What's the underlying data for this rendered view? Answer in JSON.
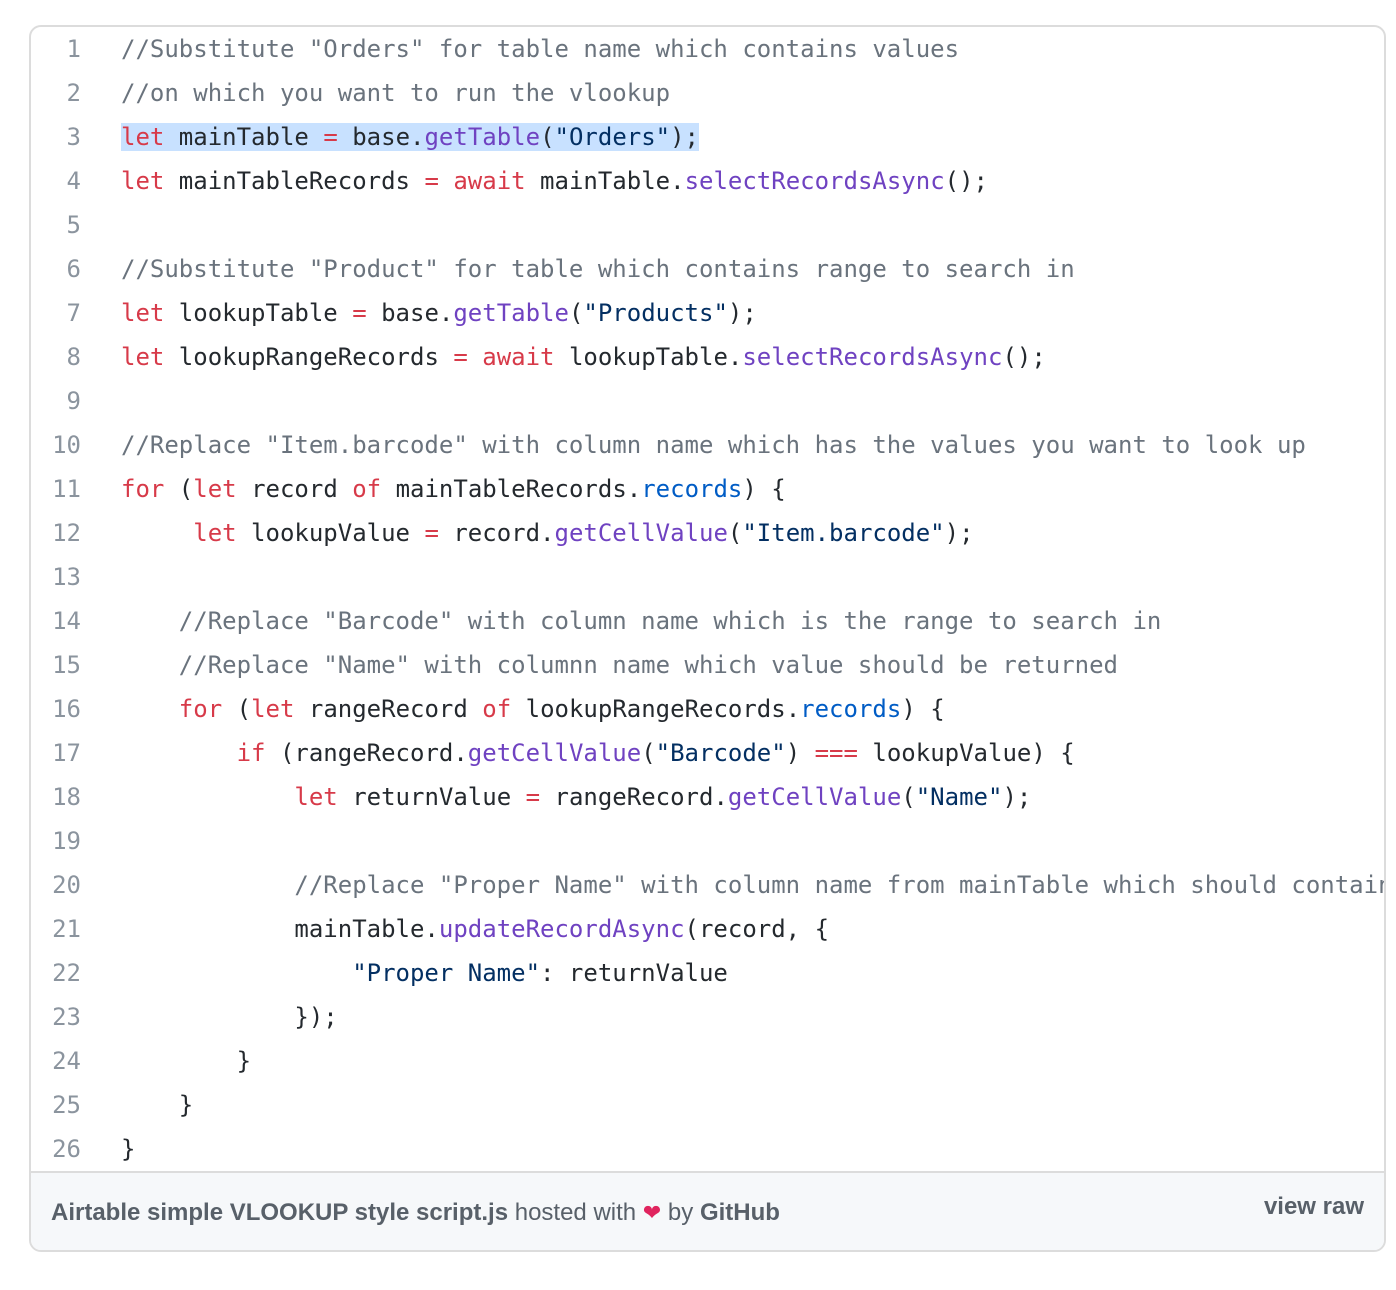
{
  "gist": {
    "filename": "Airtable simple VLOOKUP style script.js",
    "hosted_with": "hosted with",
    "heart_icon": "heart-icon",
    "by": "by",
    "host": "GitHub",
    "view_raw": "view raw"
  },
  "code": {
    "line_numbers": [
      "1",
      "2",
      "3",
      "4",
      "5",
      "6",
      "7",
      "8",
      "9",
      "10",
      "11",
      "12",
      "13",
      "14",
      "15",
      "16",
      "17",
      "18",
      "19",
      "20",
      "21",
      "22",
      "23",
      "24",
      "25",
      "26"
    ],
    "lines": [
      "//Substitute \"Orders\" for table name which contains values",
      "//on which you want to run the vlookup",
      "let mainTable = base.getTable(\"Orders\");",
      "let mainTableRecords = await mainTable.selectRecordsAsync();",
      "",
      "//Substitute \"Product\" for table which contains range to search in",
      "let lookupTable = base.getTable(\"Products\");",
      "let lookupRangeRecords = await lookupTable.selectRecordsAsync();",
      "",
      "//Replace \"Item.barcode\" with column name which has the values you want to look up",
      "for (let record of mainTableRecords.records) {",
      "     let lookupValue = record.getCellValue(\"Item.barcode\");",
      "",
      "    //Replace \"Barcode\" with column name which is the range to search in",
      "    //Replace \"Name\" with columnn name which value should be returned",
      "    for (let rangeRecord of lookupRangeRecords.records) {",
      "        if (rangeRecord.getCellValue(\"Barcode\") === lookupValue) {",
      "            let returnValue = rangeRecord.getCellValue(\"Name\");",
      "",
      "            //Replace \"Proper Name\" with column name from mainTable which should contain the returned value",
      "            mainTable.updateRecordAsync(record, {",
      "                \"Proper Name\": returnValue",
      "            });",
      "        }",
      "    }",
      "}"
    ],
    "highlighted_line": 3
  },
  "colors": {
    "comment": "#6a737d",
    "keyword": "#d73a49",
    "function": "#6f42c1",
    "string": "#032f62",
    "property": "#005cc5",
    "selection": "#c8e1ff"
  }
}
